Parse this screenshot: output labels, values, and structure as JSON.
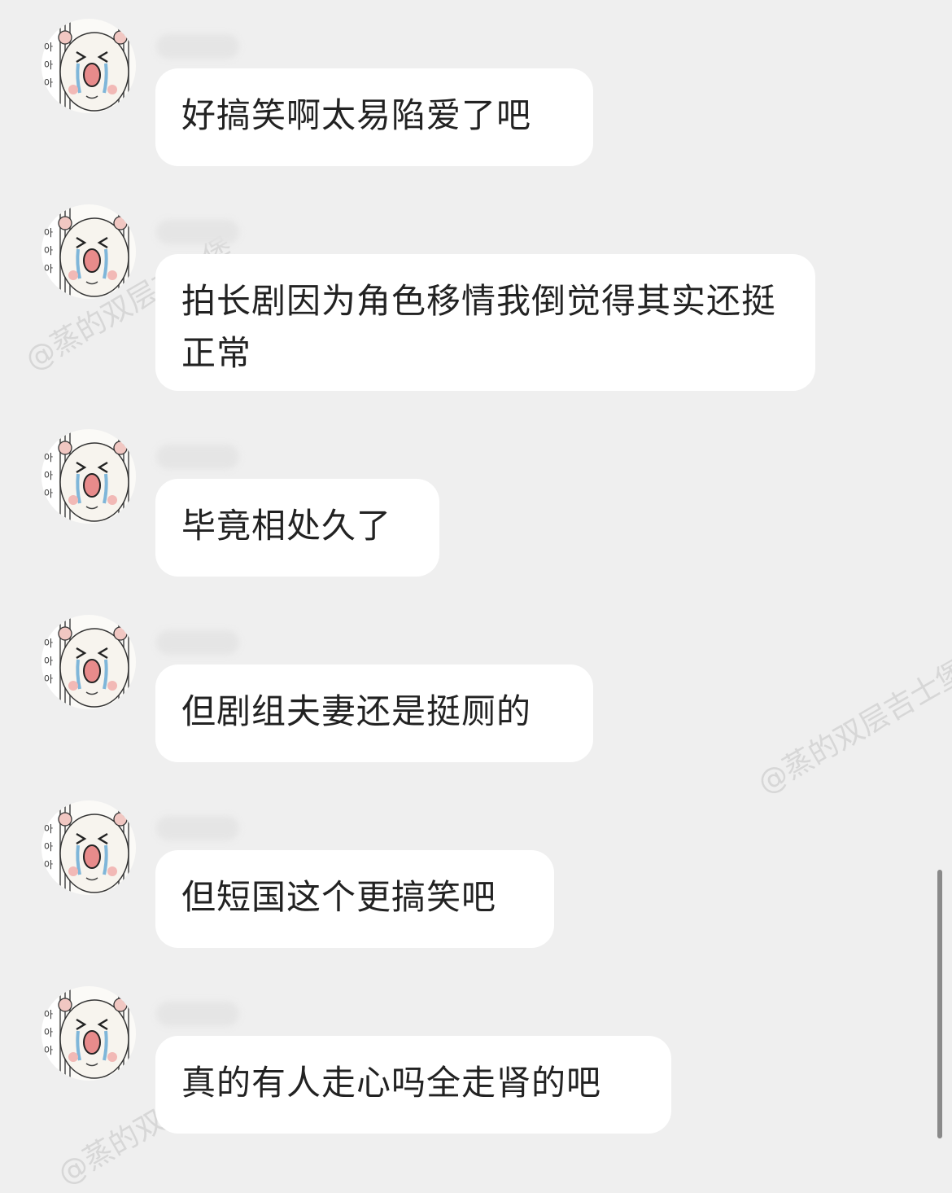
{
  "watermark": "@蒸的双层吉士堡",
  "avatar": {
    "caption": "아",
    "icon": "crying-bear-icon"
  },
  "messages": [
    {
      "text": "好搞笑啊太易陷爱了吧"
    },
    {
      "text": "拍长剧因为角色移情我倒觉得其实还挺正常"
    },
    {
      "text": "毕竟相处久了"
    },
    {
      "text": "但剧组夫妻还是挺厕的"
    },
    {
      "text": "但短国这个更搞笑吧"
    },
    {
      "text": "真的有人走心吗全走肾的吧"
    }
  ],
  "colors": {
    "background": "#efefef",
    "bubble": "#ffffff",
    "text": "#222222"
  }
}
